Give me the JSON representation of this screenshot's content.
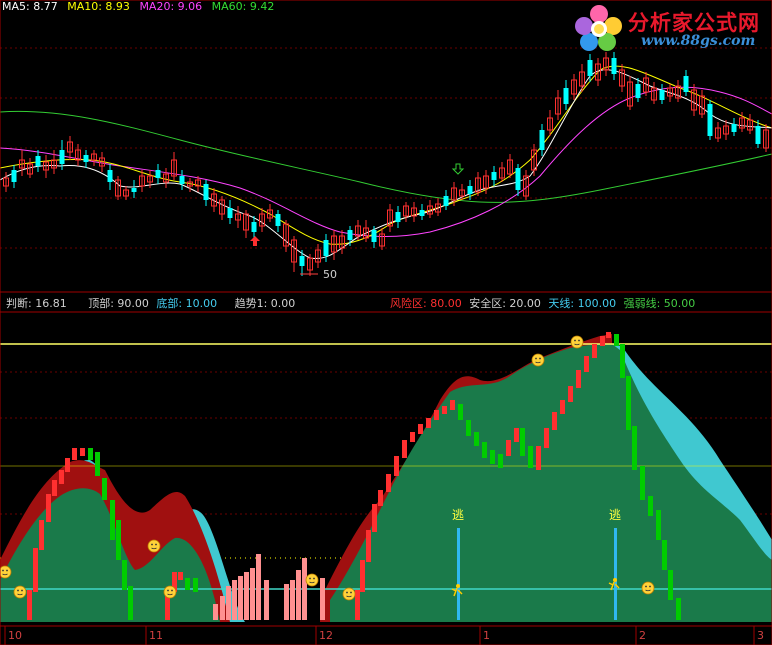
{
  "ma_legend": [
    {
      "label": "MA5: 8.77",
      "color": "#ffffff"
    },
    {
      "label": "MA10: 8.93",
      "color": "#ffff00"
    },
    {
      "label": "MA20: 9.06",
      "color": "#ff44ff"
    },
    {
      "label": "MA60: 9.42",
      "color": "#33dd33"
    }
  ],
  "indicator_legend_left": [
    {
      "label": "判断: 16.81",
      "color": "#d0d0d0"
    },
    {
      "label": "顶部: 90.00",
      "color": "#d0d0d0"
    },
    {
      "label": "底部: 10.00",
      "color": "#44ccee"
    },
    {
      "label": "趋势1: 0.00",
      "color": "#d0d0d0"
    }
  ],
  "indicator_legend_right": [
    {
      "label": "风险区: 80.00",
      "color": "#ff3030"
    },
    {
      "label": "安全区: 20.00",
      "color": "#d0d0d0"
    },
    {
      "label": "天线: 100.00",
      "color": "#44ccee"
    },
    {
      "label": "强弱线: 50.00",
      "color": "#44cc44"
    }
  ],
  "low_price_label": "50",
  "escape_label": "逃",
  "logo": {
    "name": "分析家公式网",
    "url": "www.88gs.com"
  },
  "time_axis": [
    "10",
    "11",
    "12",
    "1",
    "2",
    "3"
  ],
  "colors": {
    "up": "#ff3030",
    "down": "#00ffff",
    "ma5": "#ffffff",
    "ma10": "#ffff00",
    "ma20": "#ff44ff",
    "ma60": "#33cc33",
    "fill_green": "#1a7a4a",
    "fill_red": "#a01010",
    "fill_cyan": "#40c8d0"
  }
}
